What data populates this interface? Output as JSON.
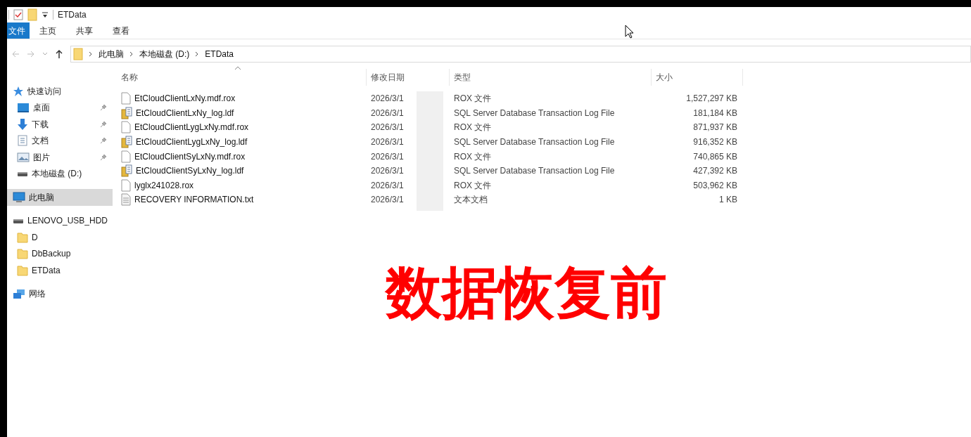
{
  "window": {
    "title": "ETData"
  },
  "ribbon_tabs": [
    {
      "label": "文件",
      "kind": "file"
    },
    {
      "label": "主页",
      "kind": "tab"
    },
    {
      "label": "共享",
      "kind": "tab"
    },
    {
      "label": "查看",
      "kind": "tab"
    }
  ],
  "address_bar": {
    "crumbs": [
      "此电脑",
      "本地磁盘 (D:)",
      "ETData"
    ]
  },
  "sidebar": {
    "items": [
      {
        "label": "快速访问",
        "kind": "star",
        "selected": false,
        "children": [
          {
            "label": "桌面",
            "kind": "desktop",
            "pinned": true,
            "selected": false
          },
          {
            "label": "下载",
            "kind": "download",
            "pinned": true,
            "selected": false
          },
          {
            "label": "文档",
            "kind": "document",
            "pinned": true,
            "selected": false
          },
          {
            "label": "图片",
            "kind": "picture",
            "pinned": true,
            "selected": false
          },
          {
            "label": "本地磁盘 (D:)",
            "kind": "drive",
            "pinned": false,
            "selected": false
          }
        ]
      },
      {
        "label": "此电脑",
        "kind": "pc",
        "selected": true
      },
      {
        "label": "LENOVO_USB_HDD",
        "kind": "drive",
        "selected": false,
        "children": [
          {
            "label": "D",
            "kind": "folder",
            "pinned": false,
            "selected": false
          },
          {
            "label": "DbBackup",
            "kind": "folder",
            "pinned": false,
            "selected": false
          },
          {
            "label": "ETData",
            "kind": "folder",
            "pinned": false,
            "selected": false
          }
        ]
      },
      {
        "label": "网络",
        "kind": "network",
        "selected": false
      }
    ]
  },
  "table": {
    "columns": [
      "名称",
      "修改日期",
      "类型",
      "大小"
    ],
    "rows": [
      {
        "name": "EtCloudClientLxNy.mdf.rox",
        "kind": "blank",
        "date": "2026/3/1",
        "type": "ROX 文件",
        "size": "1,527,297 KB"
      },
      {
        "name": "EtCloudClientLxNy_log.ldf",
        "kind": "log",
        "date": "2026/3/1",
        "type": "SQL Server Database Transaction Log File",
        "size": "181,184 KB"
      },
      {
        "name": "EtCloudClientLygLxNy.mdf.rox",
        "kind": "blank",
        "date": "2026/3/1",
        "type": "ROX 文件",
        "size": "871,937 KB"
      },
      {
        "name": "EtCloudClientLygLxNy_log.ldf",
        "kind": "log",
        "date": "2026/3/1",
        "type": "SQL Server Database Transaction Log File",
        "size": "916,352 KB"
      },
      {
        "name": "EtCloudClientSyLxNy.mdf.rox",
        "kind": "blank",
        "date": "2026/3/1",
        "type": "ROX 文件",
        "size": "740,865 KB"
      },
      {
        "name": "EtCloudClientSyLxNy_log.ldf",
        "kind": "log",
        "date": "2026/3/1",
        "type": "SQL Server Database Transaction Log File",
        "size": "427,392 KB"
      },
      {
        "name": "lyglx241028.rox",
        "kind": "blank",
        "date": "2026/3/1",
        "type": "ROX 文件",
        "size": "503,962 KB"
      },
      {
        "name": "RECOVERY INFORMATION.txt",
        "kind": "text",
        "date": "2026/3/1",
        "type": "文本文档",
        "size": "1 KB"
      }
    ]
  },
  "overlay_caption": "数据恢复前"
}
